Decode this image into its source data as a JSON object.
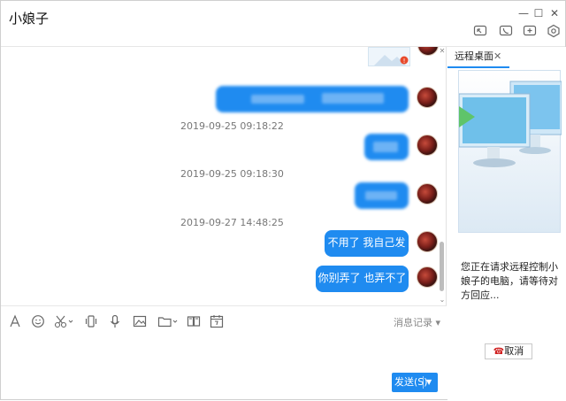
{
  "window": {
    "title": "小娘子",
    "controls": {
      "minimize": "—",
      "maximize": "☐",
      "close": "✕"
    }
  },
  "toolbar": {
    "icons": [
      "remote-assist-icon",
      "phone-icon",
      "add-icon",
      "settings-icon"
    ]
  },
  "chat": {
    "messages": [
      {
        "type": "image",
        "timestamp": ""
      },
      {
        "type": "text",
        "text": "",
        "blurred": true
      },
      {
        "type": "timestamp",
        "text": "2019-09-25 09:18:22"
      },
      {
        "type": "text",
        "text": "",
        "blurred": true
      },
      {
        "type": "timestamp",
        "text": "2019-09-25 09:18:30"
      },
      {
        "type": "text",
        "text": "",
        "blurred": true
      },
      {
        "type": "timestamp",
        "text": "2019-09-27 14:48:25"
      },
      {
        "type": "text",
        "text": "不用了 我自己发",
        "blurred": false
      },
      {
        "type": "text",
        "text": "你别弄了 也弄不了",
        "blurred": false
      }
    ]
  },
  "input_toolbar": {
    "icons": [
      "font-icon",
      "emoji-icon",
      "scissors-icon",
      "shake-icon",
      "mic-icon",
      "image-icon",
      "folder-icon",
      "screen-share-icon",
      "calendar-icon"
    ],
    "history_label": "消息记录",
    "send_label": "发送(S)"
  },
  "side_panel": {
    "tab_label": "远程桌面",
    "tab_close": "✕",
    "request_text": "您正在请求远程控制小娘子的电脑，请等待对方回应...",
    "cancel_label": "取消"
  }
}
